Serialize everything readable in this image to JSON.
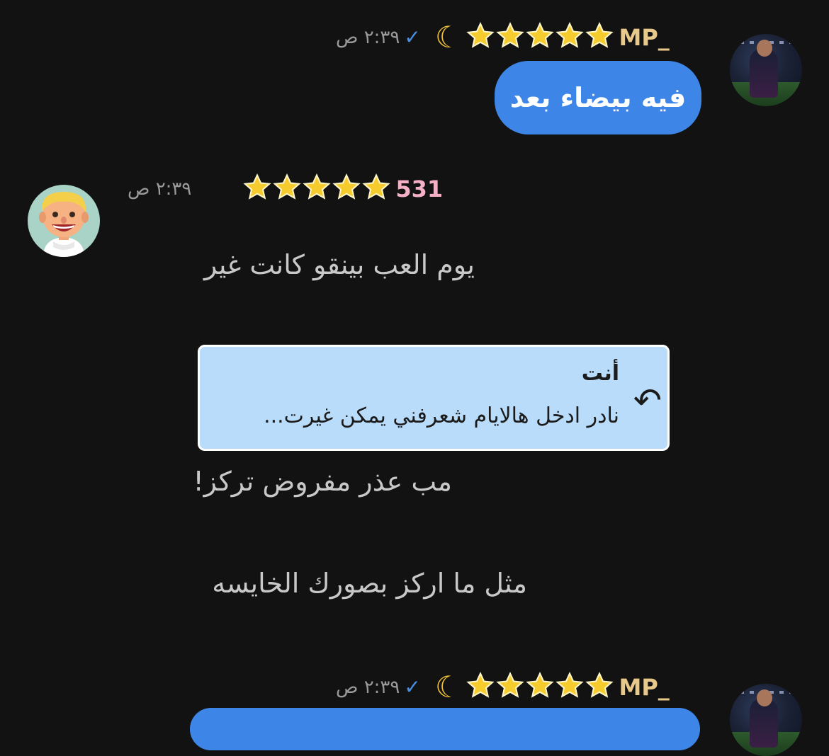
{
  "messages": [
    {
      "sender": "MP_",
      "time": "٢:٣٩ ص",
      "text": "فيه بيضاء بعد",
      "stars": 5,
      "icons": [
        "moon-icon",
        "check-icon"
      ]
    },
    {
      "sender": "531",
      "time": "٢:٣٩ ص",
      "stars": 5,
      "lines": [
        "يوم العب بينقو كانت غير",
        "مب عذر مفروض تركز!",
        "مثل ما اركز بصورك الخايسه"
      ],
      "reply": {
        "author": "أنت",
        "snippet": "نادر ادخل هالايام شعرفني يمكن غيرت..."
      }
    },
    {
      "sender": "MP_",
      "time": "٢:٣٩ ص",
      "stars": 5
    }
  ],
  "colors": {
    "background": "#121212",
    "outgoing_bubble": "#3d86e8",
    "reply_box": "#b9dcfa",
    "username": "#e8c98a",
    "incoming_name": "#f5b0c6",
    "tick": "#4a90e2"
  }
}
